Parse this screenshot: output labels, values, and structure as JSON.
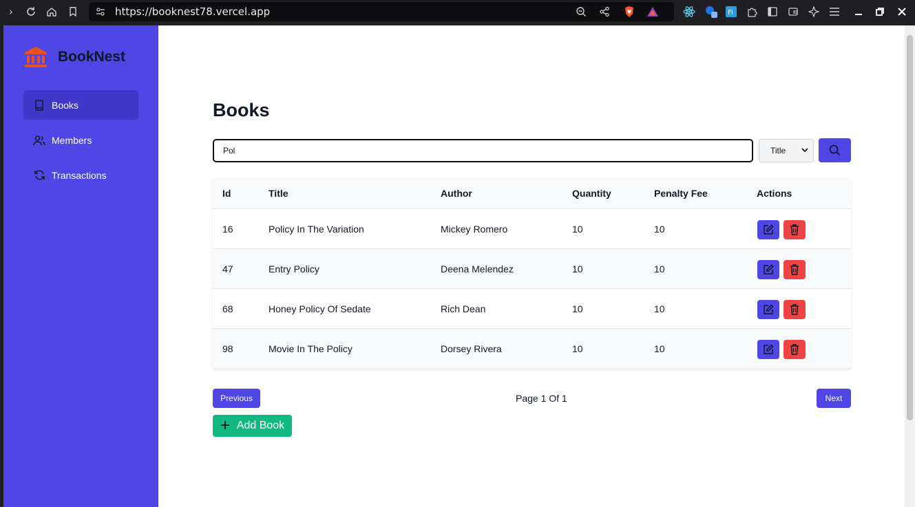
{
  "browser": {
    "url": "https://booknest78.vercel.app"
  },
  "brand": {
    "name": "BookNest"
  },
  "sidebar": {
    "items": [
      {
        "label": "Books"
      },
      {
        "label": "Members"
      },
      {
        "label": "Transactions"
      }
    ]
  },
  "page": {
    "title": "Books"
  },
  "search": {
    "value": "Pol",
    "filter_selected": "Title"
  },
  "table": {
    "columns": [
      "Id",
      "Title",
      "Author",
      "Quantity",
      "Penalty Fee",
      "Actions"
    ],
    "rows": [
      {
        "id": "16",
        "title": "Policy In The Variation",
        "author": "Mickey Romero",
        "quantity": "10",
        "penalty_fee": "10"
      },
      {
        "id": "47",
        "title": "Entry Policy",
        "author": "Deena Melendez",
        "quantity": "10",
        "penalty_fee": "10"
      },
      {
        "id": "68",
        "title": "Honey Policy Of Sedate",
        "author": "Rich Dean",
        "quantity": "10",
        "penalty_fee": "10"
      },
      {
        "id": "98",
        "title": "Movie In The Policy",
        "author": "Dorsey Rivera",
        "quantity": "10",
        "penalty_fee": "10"
      }
    ]
  },
  "pagination": {
    "previous_label": "Previous",
    "page_info": "Page 1 Of 1",
    "next_label": "Next"
  },
  "actions": {
    "add_label": "Add Book"
  },
  "colors": {
    "primary": "#4f46e5",
    "danger": "#ef4444",
    "success": "#10b981",
    "brand_logo": "#e8501c"
  }
}
